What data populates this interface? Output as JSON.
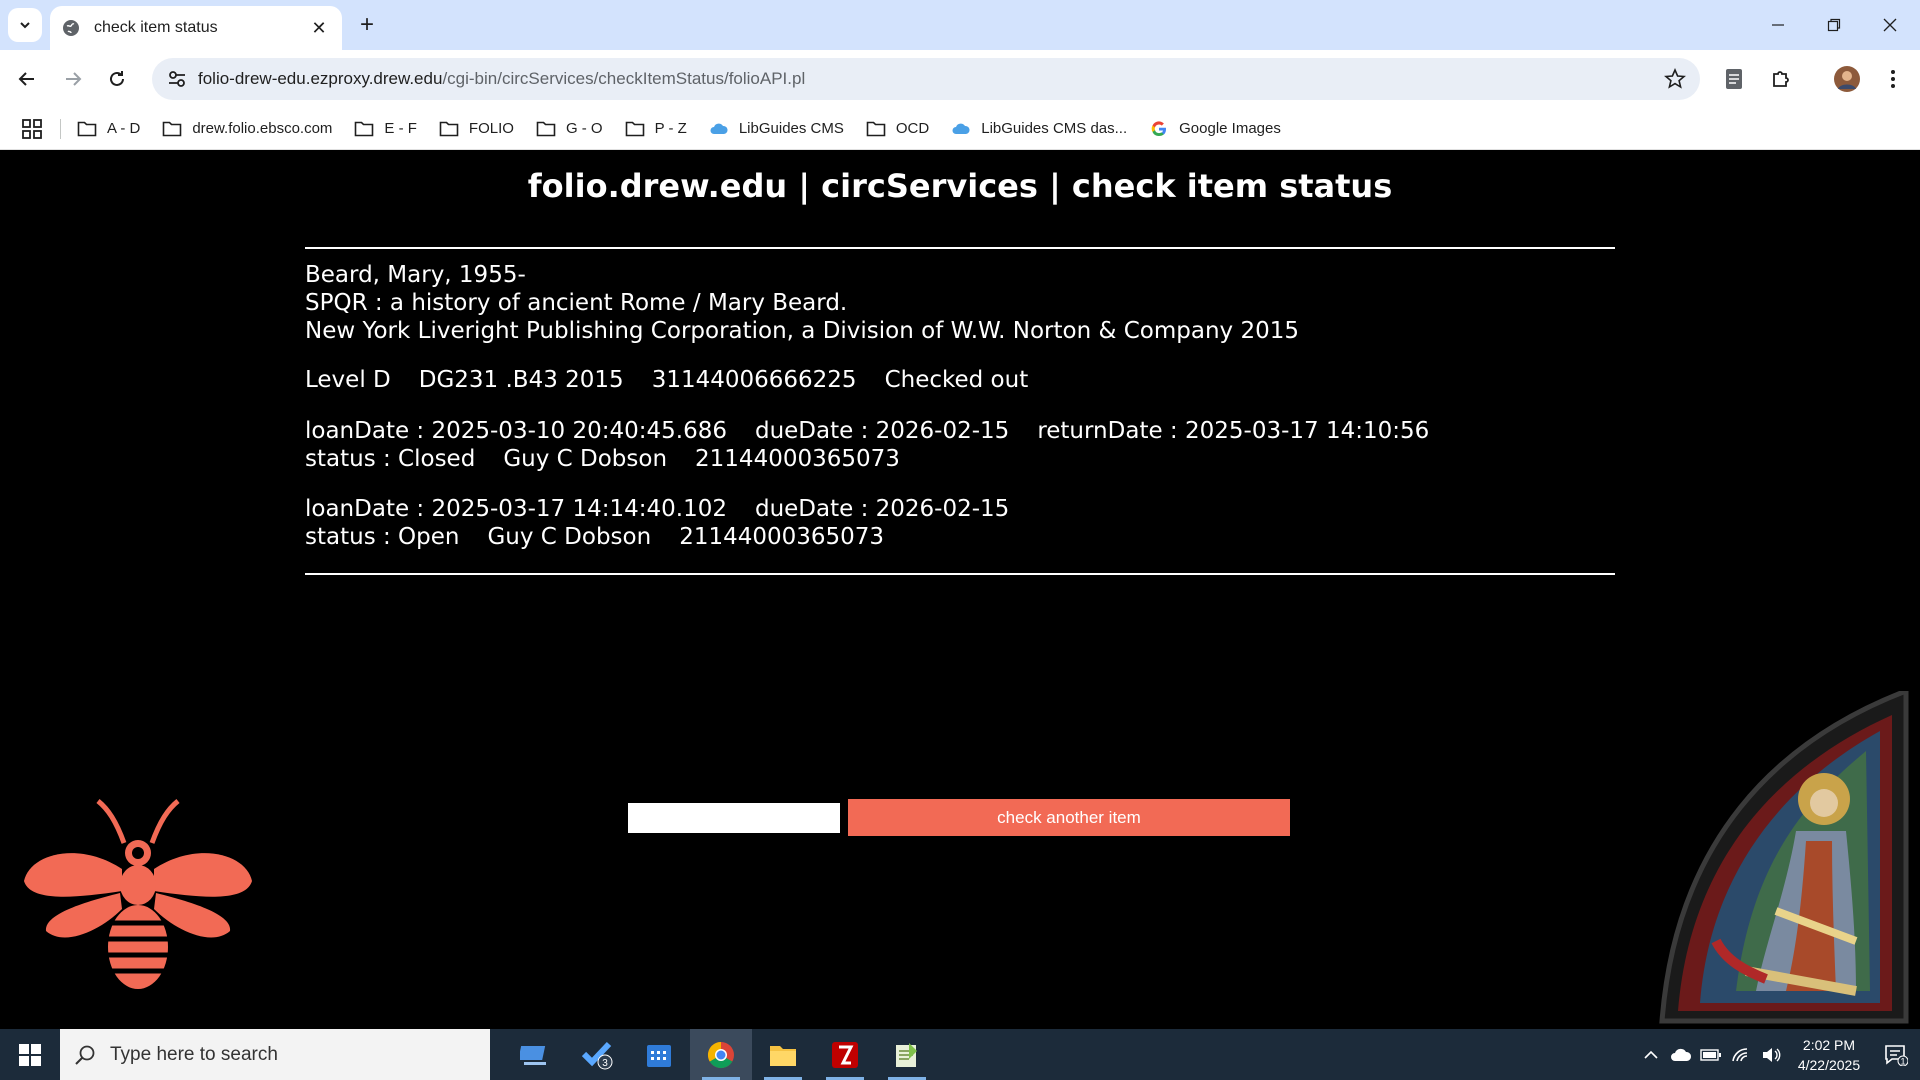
{
  "browser": {
    "tab_title": "check item status",
    "url_host": "folio-drew-edu.ezproxy.drew.edu",
    "url_path": "/cgi-bin/circServices/checkItemStatus/folioAPI.pl",
    "bookmarks": [
      {
        "label": "A - D",
        "icon": "folder-icon"
      },
      {
        "label": "drew.folio.ebsco.com",
        "icon": "folder-icon"
      },
      {
        "label": "E - F",
        "icon": "folder-icon"
      },
      {
        "label": "FOLIO",
        "icon": "folder-icon"
      },
      {
        "label": "G - O",
        "icon": "folder-icon"
      },
      {
        "label": "P - Z",
        "icon": "folder-icon"
      },
      {
        "label": "LibGuides CMS",
        "icon": "cloud-icon"
      },
      {
        "label": "OCD",
        "icon": "folder-icon"
      },
      {
        "label": "LibGuides CMS das...",
        "icon": "cloud-icon"
      },
      {
        "label": "Google Images",
        "icon": "google-icon"
      }
    ]
  },
  "page": {
    "title": "folio.drew.edu | circServices | check item status",
    "record": {
      "author": "Beard, Mary, 1955-",
      "title": "SPQR : a history of ancient Rome / Mary Beard.",
      "publication": "New York Liveright Publishing Corporation, a Division of W.W. Norton & Company 2015",
      "location": "Level D",
      "call_number": "DG231 .B43 2015",
      "barcode": "31144006666225",
      "item_status": "Checked out"
    },
    "loans": [
      {
        "loan_date": "loanDate : 2025-03-10 20:40:45.686",
        "due_date": "dueDate : 2026-02-15",
        "return_date": "returnDate : 2025-03-17 14:10:56",
        "status": "status : Closed",
        "patron": "Guy C Dobson",
        "patron_barcode": "21144000365073"
      },
      {
        "loan_date": "loanDate : 2025-03-17 14:14:40.102",
        "due_date": "dueDate : 2026-02-15",
        "status": "status : Open",
        "patron": "Guy C Dobson",
        "patron_barcode": "21144000365073"
      }
    ],
    "form": {
      "input_value": "",
      "button_label": "check another item"
    },
    "colors": {
      "accent": "#f26a55",
      "background": "#000000"
    }
  },
  "taskbar": {
    "search_placeholder": "Type here to search",
    "badge_count": "3",
    "time": "2:02 PM",
    "date": "4/22/2025",
    "notification_count": "1"
  }
}
